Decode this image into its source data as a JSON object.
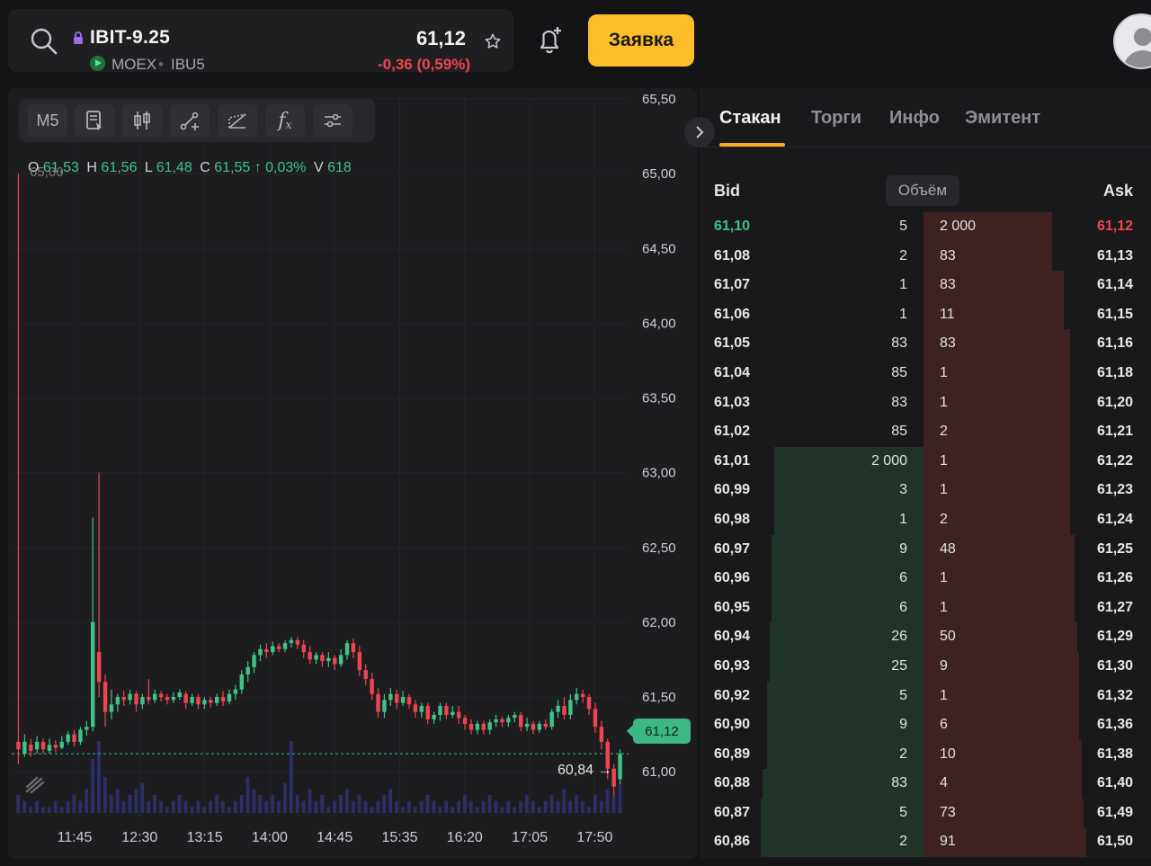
{
  "header": {
    "symbol": "IBIT-9.25",
    "exchange": "MOEX",
    "separator": "•",
    "board": "IBU5",
    "price": "61,12",
    "change": "-0,36 (0,59%)",
    "order_button": "Заявка",
    "icons": [
      "search-icon",
      "lock-icon",
      "play-icon",
      "star-icon",
      "bell-plus-icon",
      "avatar"
    ]
  },
  "chart": {
    "timeframe": "M5",
    "toolbar_icons": [
      "indicators-template-icon",
      "candle-type-icon",
      "trendline-icon",
      "pattern-icon",
      "function-icon",
      "settings-sliders-icon"
    ],
    "ohlc": {
      "o_label": "O",
      "o": "61,53",
      "h_label": "H",
      "h": "61,56",
      "l_label": "L",
      "l": "61,48",
      "c_label": "C",
      "c": "61,55",
      "arrow": "↑",
      "pct": "0,03%",
      "v_label": "V",
      "v": "618"
    },
    "top_left_marker": "65,00",
    "last_price_tag": "61,12",
    "low_marker": "60,84 →",
    "colors": {
      "up": "#3ec389",
      "down": "#f0454f",
      "volume": "#2b2f66",
      "background": "#1d1d20"
    }
  },
  "chart_data": {
    "type": "candlestick",
    "title": "",
    "y_ticks": [
      "65,50",
      "65,00",
      "64,50",
      "64,00",
      "63,50",
      "63,00",
      "62,50",
      "62,00",
      "61,50",
      "61,00"
    ],
    "x_ticks": [
      "11:45",
      "12:30",
      "13:15",
      "14:00",
      "14:45",
      "15:35",
      "16:20",
      "17:05",
      "17:50"
    ],
    "ylim": [
      60.7,
      65.5
    ],
    "last_price": 61.12,
    "session_low": 60.84,
    "candles": [
      {
        "o": 61.2,
        "c": 61.15,
        "h": 65.0,
        "l": 61.05
      },
      {
        "o": 61.12,
        "c": 61.2,
        "h": 61.25,
        "l": 61.1
      },
      {
        "o": 61.18,
        "c": 61.14,
        "h": 61.22,
        "l": 61.1
      },
      {
        "o": 61.15,
        "c": 61.2,
        "h": 61.24,
        "l": 61.12
      },
      {
        "o": 61.2,
        "c": 61.15,
        "h": 61.22,
        "l": 61.12
      },
      {
        "o": 61.14,
        "c": 61.18,
        "h": 61.22,
        "l": 61.12
      },
      {
        "o": 61.18,
        "c": 61.16,
        "h": 61.21,
        "l": 61.13
      },
      {
        "o": 61.16,
        "c": 61.2,
        "h": 61.24,
        "l": 61.15
      },
      {
        "o": 61.2,
        "c": 61.25,
        "h": 61.27,
        "l": 61.18
      },
      {
        "o": 61.25,
        "c": 61.2,
        "h": 61.28,
        "l": 61.17
      },
      {
        "o": 61.2,
        "c": 61.28,
        "h": 61.3,
        "l": 61.18
      },
      {
        "o": 61.28,
        "c": 61.3,
        "h": 61.34,
        "l": 61.24
      },
      {
        "o": 61.3,
        "c": 62.0,
        "h": 62.7,
        "l": 61.27
      },
      {
        "o": 61.8,
        "c": 61.6,
        "h": 63.0,
        "l": 61.5
      },
      {
        "o": 61.6,
        "c": 61.4,
        "h": 61.65,
        "l": 61.3
      },
      {
        "o": 61.4,
        "c": 61.45,
        "h": 61.55,
        "l": 61.35
      },
      {
        "o": 61.45,
        "c": 61.5,
        "h": 61.52,
        "l": 61.4
      },
      {
        "o": 61.5,
        "c": 61.48,
        "h": 61.54,
        "l": 61.44
      },
      {
        "o": 61.48,
        "c": 61.52,
        "h": 61.55,
        "l": 61.45
      },
      {
        "o": 61.52,
        "c": 61.45,
        "h": 61.54,
        "l": 61.4
      },
      {
        "o": 61.45,
        "c": 61.5,
        "h": 61.52,
        "l": 61.42
      },
      {
        "o": 61.5,
        "c": 61.48,
        "h": 61.62,
        "l": 61.45
      },
      {
        "o": 61.48,
        "c": 61.52,
        "h": 61.55,
        "l": 61.46
      },
      {
        "o": 61.52,
        "c": 61.5,
        "h": 61.54,
        "l": 61.47
      },
      {
        "o": 61.5,
        "c": 61.48,
        "h": 61.52,
        "l": 61.45
      },
      {
        "o": 61.48,
        "c": 61.5,
        "h": 61.53,
        "l": 61.46
      },
      {
        "o": 61.5,
        "c": 61.53,
        "h": 61.55,
        "l": 61.48
      },
      {
        "o": 61.52,
        "c": 61.46,
        "h": 61.54,
        "l": 61.42
      },
      {
        "o": 61.46,
        "c": 61.5,
        "h": 61.52,
        "l": 61.44
      },
      {
        "o": 61.5,
        "c": 61.45,
        "h": 61.52,
        "l": 61.42
      },
      {
        "o": 61.45,
        "c": 61.48,
        "h": 61.5,
        "l": 61.42
      },
      {
        "o": 61.48,
        "c": 61.46,
        "h": 61.5,
        "l": 61.43
      },
      {
        "o": 61.46,
        "c": 61.5,
        "h": 61.52,
        "l": 61.44
      },
      {
        "o": 61.5,
        "c": 61.47,
        "h": 61.54,
        "l": 61.44
      },
      {
        "o": 61.47,
        "c": 61.52,
        "h": 61.55,
        "l": 61.45
      },
      {
        "o": 61.52,
        "c": 61.55,
        "h": 61.58,
        "l": 61.48
      },
      {
        "o": 61.55,
        "c": 61.65,
        "h": 61.68,
        "l": 61.52
      },
      {
        "o": 61.65,
        "c": 61.7,
        "h": 61.74,
        "l": 61.6
      },
      {
        "o": 61.7,
        "c": 61.78,
        "h": 61.8,
        "l": 61.66
      },
      {
        "o": 61.78,
        "c": 61.82,
        "h": 61.85,
        "l": 61.74
      },
      {
        "o": 61.82,
        "c": 61.8,
        "h": 61.86,
        "l": 61.76
      },
      {
        "o": 61.8,
        "c": 61.84,
        "h": 61.87,
        "l": 61.78
      },
      {
        "o": 61.84,
        "c": 61.82,
        "h": 61.86,
        "l": 61.8
      },
      {
        "o": 61.82,
        "c": 61.86,
        "h": 61.88,
        "l": 61.8
      },
      {
        "o": 61.86,
        "c": 61.88,
        "h": 61.9,
        "l": 61.83
      },
      {
        "o": 61.88,
        "c": 61.85,
        "h": 61.9,
        "l": 61.82
      },
      {
        "o": 61.85,
        "c": 61.8,
        "h": 61.88,
        "l": 61.76
      },
      {
        "o": 61.8,
        "c": 61.75,
        "h": 61.84,
        "l": 61.72
      },
      {
        "o": 61.75,
        "c": 61.78,
        "h": 61.8,
        "l": 61.72
      },
      {
        "o": 61.78,
        "c": 61.74,
        "h": 61.8,
        "l": 61.7
      },
      {
        "o": 61.74,
        "c": 61.76,
        "h": 61.8,
        "l": 61.7
      },
      {
        "o": 61.76,
        "c": 61.72,
        "h": 61.78,
        "l": 61.68
      },
      {
        "o": 61.72,
        "c": 61.78,
        "h": 61.82,
        "l": 61.7
      },
      {
        "o": 61.78,
        "c": 61.86,
        "h": 61.88,
        "l": 61.75
      },
      {
        "o": 61.86,
        "c": 61.8,
        "h": 61.89,
        "l": 61.76
      },
      {
        "o": 61.8,
        "c": 61.68,
        "h": 61.84,
        "l": 61.64
      },
      {
        "o": 61.68,
        "c": 61.62,
        "h": 61.72,
        "l": 61.58
      },
      {
        "o": 61.62,
        "c": 61.52,
        "h": 61.66,
        "l": 61.48
      },
      {
        "o": 61.52,
        "c": 61.4,
        "h": 61.56,
        "l": 61.36
      },
      {
        "o": 61.4,
        "c": 61.48,
        "h": 61.52,
        "l": 61.36
      },
      {
        "o": 61.48,
        "c": 61.52,
        "h": 61.56,
        "l": 61.44
      },
      {
        "o": 61.52,
        "c": 61.46,
        "h": 61.55,
        "l": 61.42
      },
      {
        "o": 61.46,
        "c": 61.5,
        "h": 61.54,
        "l": 61.44
      },
      {
        "o": 61.5,
        "c": 61.45,
        "h": 61.52,
        "l": 61.42
      },
      {
        "o": 61.45,
        "c": 61.4,
        "h": 61.48,
        "l": 61.36
      },
      {
        "o": 61.4,
        "c": 61.44,
        "h": 61.46,
        "l": 61.36
      },
      {
        "o": 61.44,
        "c": 61.35,
        "h": 61.46,
        "l": 61.32
      },
      {
        "o": 61.35,
        "c": 61.38,
        "h": 61.4,
        "l": 61.32
      },
      {
        "o": 61.38,
        "c": 61.44,
        "h": 61.46,
        "l": 61.34
      },
      {
        "o": 61.44,
        "c": 61.38,
        "h": 61.46,
        "l": 61.35
      },
      {
        "o": 61.38,
        "c": 61.4,
        "h": 61.44,
        "l": 61.36
      },
      {
        "o": 61.4,
        "c": 61.36,
        "h": 61.44,
        "l": 61.32
      },
      {
        "o": 61.36,
        "c": 61.32,
        "h": 61.38,
        "l": 61.28
      },
      {
        "o": 61.32,
        "c": 61.28,
        "h": 61.35,
        "l": 61.25
      },
      {
        "o": 61.28,
        "c": 61.32,
        "h": 61.34,
        "l": 61.25
      },
      {
        "o": 61.32,
        "c": 61.28,
        "h": 61.34,
        "l": 61.25
      },
      {
        "o": 61.28,
        "c": 61.33,
        "h": 61.35,
        "l": 61.25
      },
      {
        "o": 61.33,
        "c": 61.35,
        "h": 61.38,
        "l": 61.3
      },
      {
        "o": 61.35,
        "c": 61.33,
        "h": 61.37,
        "l": 61.3
      },
      {
        "o": 61.33,
        "c": 61.36,
        "h": 61.38,
        "l": 61.3
      },
      {
        "o": 61.36,
        "c": 61.38,
        "h": 61.4,
        "l": 61.33
      },
      {
        "o": 61.38,
        "c": 61.3,
        "h": 61.4,
        "l": 61.27
      },
      {
        "o": 61.3,
        "c": 61.32,
        "h": 61.36,
        "l": 61.27
      },
      {
        "o": 61.32,
        "c": 61.28,
        "h": 61.34,
        "l": 61.25
      },
      {
        "o": 61.28,
        "c": 61.32,
        "h": 61.34,
        "l": 61.26
      },
      {
        "o": 61.32,
        "c": 61.3,
        "h": 61.35,
        "l": 61.28
      },
      {
        "o": 61.3,
        "c": 61.4,
        "h": 61.42,
        "l": 61.28
      },
      {
        "o": 61.4,
        "c": 61.44,
        "h": 61.48,
        "l": 61.36
      },
      {
        "o": 61.44,
        "c": 61.38,
        "h": 61.5,
        "l": 61.35
      },
      {
        "o": 61.38,
        "c": 61.48,
        "h": 61.52,
        "l": 61.35
      },
      {
        "o": 61.48,
        "c": 61.52,
        "h": 61.56,
        "l": 61.45
      },
      {
        "o": 61.52,
        "c": 61.5,
        "h": 61.55,
        "l": 61.46
      },
      {
        "o": 61.5,
        "c": 61.42,
        "h": 61.52,
        "l": 61.38
      },
      {
        "o": 61.42,
        "c": 61.3,
        "h": 61.46,
        "l": 61.26
      },
      {
        "o": 61.3,
        "c": 61.2,
        "h": 61.34,
        "l": 61.15
      },
      {
        "o": 61.2,
        "c": 61.02,
        "h": 61.22,
        "l": 60.95
      },
      {
        "o": 61.02,
        "c": 60.9,
        "h": 61.05,
        "l": 60.84
      },
      {
        "o": 60.95,
        "c": 61.12,
        "h": 61.15,
        "l": 60.92
      }
    ],
    "volumes": [
      3,
      2,
      1,
      2,
      1,
      1,
      2,
      1,
      2,
      3,
      2,
      4,
      9,
      12,
      6,
      3,
      4,
      2,
      3,
      4,
      5,
      2,
      3,
      2,
      1,
      2,
      3,
      2,
      1,
      2,
      1,
      2,
      3,
      2,
      1,
      2,
      3,
      6,
      4,
      3,
      2,
      3,
      2,
      5,
      12,
      3,
      2,
      4,
      2,
      3,
      1,
      2,
      3,
      4,
      2,
      3,
      2,
      1,
      2,
      3,
      4,
      2,
      1,
      2,
      1,
      2,
      3,
      2,
      1,
      2,
      1,
      2,
      3,
      2,
      1,
      2,
      3,
      2,
      1,
      2,
      1,
      2,
      3,
      2,
      1,
      2,
      3,
      2,
      4,
      2,
      3,
      2,
      1,
      3,
      2,
      4,
      3,
      5
    ]
  },
  "book": {
    "tabs": [
      "Стакан",
      "Торги",
      "Инфо",
      "Эмитент"
    ],
    "active_tab": "Стакан",
    "bid_header": "Bid",
    "volume_header": "Объём",
    "ask_header": "Ask",
    "rows": [
      {
        "bid": "61,10",
        "bid_vol": "5",
        "ask_vol": "2 000",
        "ask": "61,12",
        "bid_depth": 0.0,
        "ask_depth": 0.57
      },
      {
        "bid": "61,08",
        "bid_vol": "2",
        "ask_vol": "83",
        "ask": "61,13",
        "bid_depth": 0.0,
        "ask_depth": 0.57
      },
      {
        "bid": "61,07",
        "bid_vol": "1",
        "ask_vol": "83",
        "ask": "61,14",
        "bid_depth": 0.0,
        "ask_depth": 0.62
      },
      {
        "bid": "61,06",
        "bid_vol": "1",
        "ask_vol": "11",
        "ask": "61,15",
        "bid_depth": 0.0,
        "ask_depth": 0.62
      },
      {
        "bid": "61,05",
        "bid_vol": "83",
        "ask_vol": "83",
        "ask": "61,16",
        "bid_depth": 0.0,
        "ask_depth": 0.65
      },
      {
        "bid": "61,04",
        "bid_vol": "85",
        "ask_vol": "1",
        "ask": "61,18",
        "bid_depth": 0.0,
        "ask_depth": 0.65
      },
      {
        "bid": "61,03",
        "bid_vol": "83",
        "ask_vol": "1",
        "ask": "61,20",
        "bid_depth": 0.0,
        "ask_depth": 0.65
      },
      {
        "bid": "61,02",
        "bid_vol": "85",
        "ask_vol": "2",
        "ask": "61,21",
        "bid_depth": 0.0,
        "ask_depth": 0.65
      },
      {
        "bid": "61,01",
        "bid_vol": "2 000",
        "ask_vol": "1",
        "ask": "61,22",
        "bid_depth": 0.67,
        "ask_depth": 0.65
      },
      {
        "bid": "60,99",
        "bid_vol": "3",
        "ask_vol": "1",
        "ask": "61,23",
        "bid_depth": 0.67,
        "ask_depth": 0.65
      },
      {
        "bid": "60,98",
        "bid_vol": "1",
        "ask_vol": "2",
        "ask": "61,24",
        "bid_depth": 0.67,
        "ask_depth": 0.65
      },
      {
        "bid": "60,97",
        "bid_vol": "9",
        "ask_vol": "48",
        "ask": "61,25",
        "bid_depth": 0.68,
        "ask_depth": 0.67
      },
      {
        "bid": "60,96",
        "bid_vol": "6",
        "ask_vol": "1",
        "ask": "61,26",
        "bid_depth": 0.68,
        "ask_depth": 0.67
      },
      {
        "bid": "60,95",
        "bid_vol": "6",
        "ask_vol": "1",
        "ask": "61,27",
        "bid_depth": 0.68,
        "ask_depth": 0.67
      },
      {
        "bid": "60,94",
        "bid_vol": "26",
        "ask_vol": "50",
        "ask": "61,29",
        "bid_depth": 0.69,
        "ask_depth": 0.68
      },
      {
        "bid": "60,93",
        "bid_vol": "25",
        "ask_vol": "9",
        "ask": "61,30",
        "bid_depth": 0.69,
        "ask_depth": 0.69
      },
      {
        "bid": "60,92",
        "bid_vol": "5",
        "ask_vol": "1",
        "ask": "61,32",
        "bid_depth": 0.7,
        "ask_depth": 0.69
      },
      {
        "bid": "60,90",
        "bid_vol": "9",
        "ask_vol": "6",
        "ask": "61,36",
        "bid_depth": 0.7,
        "ask_depth": 0.69
      },
      {
        "bid": "60,89",
        "bid_vol": "2",
        "ask_vol": "10",
        "ask": "61,38",
        "bid_depth": 0.7,
        "ask_depth": 0.7
      },
      {
        "bid": "60,88",
        "bid_vol": "83",
        "ask_vol": "4",
        "ask": "61,40",
        "bid_depth": 0.72,
        "ask_depth": 0.7
      },
      {
        "bid": "60,87",
        "bid_vol": "5",
        "ask_vol": "73",
        "ask": "61,49",
        "bid_depth": 0.73,
        "ask_depth": 0.71
      },
      {
        "bid": "60,86",
        "bid_vol": "2",
        "ask_vol": "91",
        "ask": "61,50",
        "bid_depth": 0.73,
        "ask_depth": 0.72
      }
    ]
  }
}
